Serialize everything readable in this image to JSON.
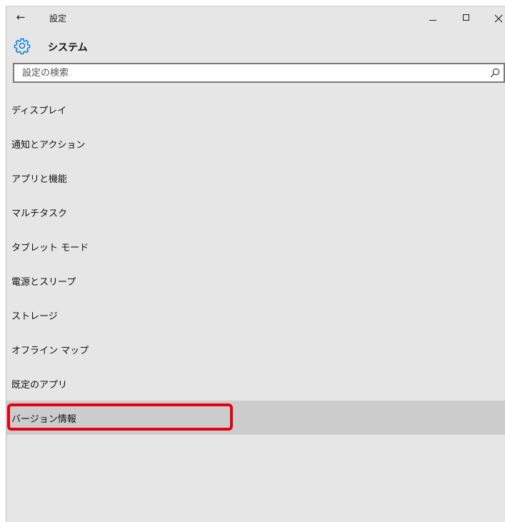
{
  "window": {
    "title": "設定",
    "back_glyph": "←",
    "controls": [
      "minimize-icon",
      "maximize-icon",
      "close-icon"
    ]
  },
  "header": {
    "icon": "gear-icon",
    "title": "システム"
  },
  "search": {
    "placeholder": "設定の検索",
    "value": "",
    "icon": "search-icon"
  },
  "nav": {
    "items": [
      {
        "label": "ディスプレイ"
      },
      {
        "label": "通知とアクション"
      },
      {
        "label": "アプリと機能"
      },
      {
        "label": "マルチタスク"
      },
      {
        "label": "タブレット モード"
      },
      {
        "label": "電源とスリープ"
      },
      {
        "label": "ストレージ"
      },
      {
        "label": "オフライン マップ"
      },
      {
        "label": "既定のアプリ"
      },
      {
        "label": "バージョン情報"
      }
    ],
    "selected_index": 9
  },
  "colors": {
    "window_bg": "#e6e6e6",
    "selected_bg": "#cccccc",
    "highlight_border": "#e60012",
    "accent_icon": "#0078d7"
  }
}
